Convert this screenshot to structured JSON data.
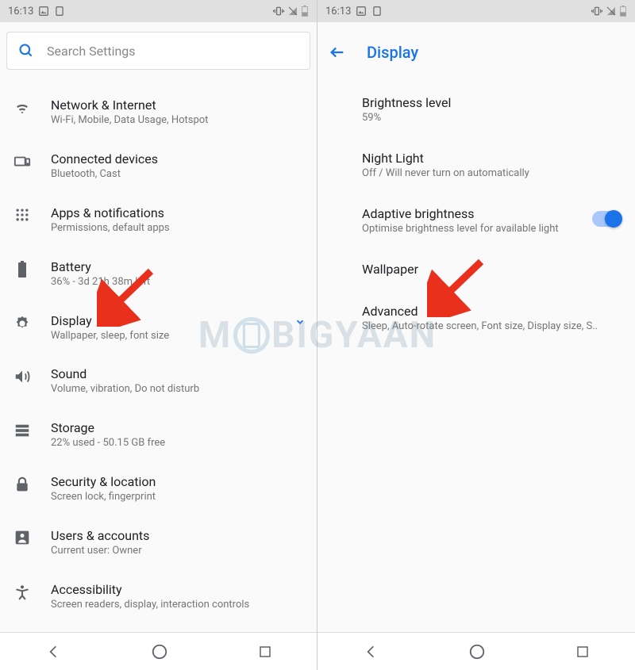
{
  "statusbar": {
    "time": "16:13"
  },
  "search": {
    "placeholder": "Search Settings"
  },
  "settings_items": [
    {
      "title": "Network & Internet",
      "sub": "Wi-Fi, Mobile, Data Usage, Hotspot"
    },
    {
      "title": "Connected devices",
      "sub": "Bluetooth, Cast"
    },
    {
      "title": "Apps & notifications",
      "sub": "Permissions, default apps"
    },
    {
      "title": "Battery",
      "sub": "36% - 3d 21h 38m left"
    },
    {
      "title": "Display",
      "sub": "Wallpaper, sleep, font size"
    },
    {
      "title": "Sound",
      "sub": "Volume, vibration, Do not disturb"
    },
    {
      "title": "Storage",
      "sub": "22% used - 50.15 GB free"
    },
    {
      "title": "Security & location",
      "sub": "Screen lock, fingerprint"
    },
    {
      "title": "Users & accounts",
      "sub": "Current user: Owner"
    },
    {
      "title": "Accessibility",
      "sub": "Screen readers, display, interaction controls"
    }
  ],
  "display_page": {
    "header": "Display",
    "items": [
      {
        "title": "Brightness level",
        "sub": "59%"
      },
      {
        "title": "Night Light",
        "sub": "Off / Will never turn on automatically"
      },
      {
        "title": "Adaptive brightness",
        "sub": "Optimise brightness level for available light",
        "toggle": true
      },
      {
        "title": "Wallpaper",
        "sub": ""
      },
      {
        "title": "Advanced",
        "sub": "Sleep, Auto-rotate screen, Font size, Display size, S.."
      }
    ]
  },
  "watermark": {
    "prefix": "M",
    "suffix": "BIGYAAN"
  }
}
